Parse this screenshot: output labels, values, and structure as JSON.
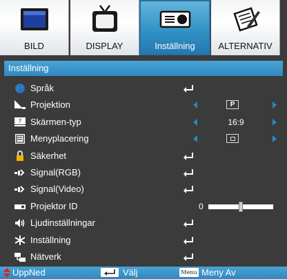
{
  "tabs": [
    {
      "label": "BILD",
      "icon": "monitor-icon"
    },
    {
      "label": "DISPLAY",
      "icon": "tv-icon"
    },
    {
      "label": "Inställning",
      "icon": "projector-icon",
      "active": true
    },
    {
      "label": "ALTERNATIV",
      "icon": "pen-paper-icon"
    }
  ],
  "section_title": "Inställning",
  "menu": {
    "items": [
      {
        "label": "Språk",
        "icon": "globe-icon",
        "control": "enter"
      },
      {
        "label": "Projektion",
        "icon": "projection-icon",
        "control": "select",
        "value": "P"
      },
      {
        "label": "Skärmen-typ",
        "icon": "screen-type-icon",
        "control": "select",
        "value": "16:9"
      },
      {
        "label": "Menyplacering",
        "icon": "menu-location-icon",
        "control": "select",
        "value": ""
      },
      {
        "label": "Säkerhet",
        "icon": "lock-icon",
        "control": "enter"
      },
      {
        "label": "Signal(RGB)",
        "icon": "signal-rgb-icon",
        "control": "enter"
      },
      {
        "label": "Signal(Video)",
        "icon": "signal-video-icon",
        "control": "enter"
      },
      {
        "label": "Projektor ID",
        "icon": "projector-id-icon",
        "control": "slider",
        "value": "0",
        "level": 0.5
      },
      {
        "label": "Ljudinställningar",
        "icon": "speaker-icon",
        "control": "enter"
      },
      {
        "label": "Inställning",
        "icon": "reset-icon",
        "control": "enter"
      },
      {
        "label": "Nätverk",
        "icon": "network-icon",
        "control": "enter"
      }
    ]
  },
  "footer": {
    "updown": "UppNed",
    "select": "Välj",
    "menu_key": "Menu",
    "menu_off": "Meny Av"
  },
  "colors": {
    "accent": "#2f88c0",
    "background": "#3b3b3b"
  }
}
